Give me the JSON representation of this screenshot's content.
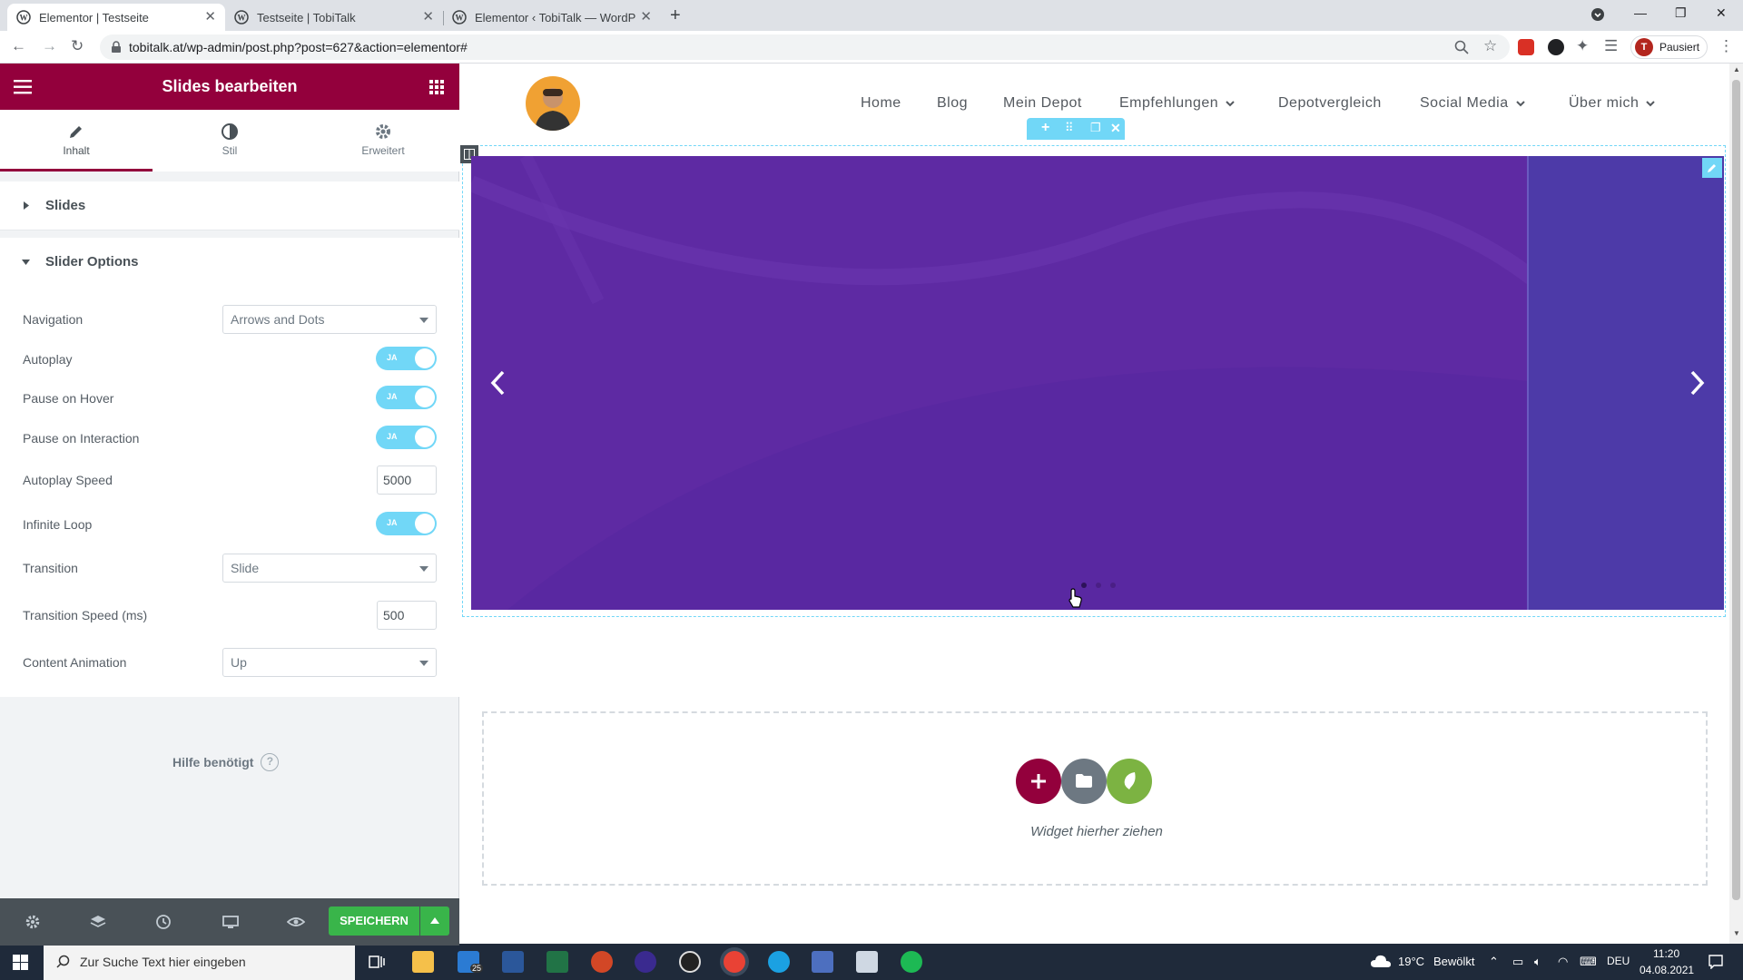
{
  "browser": {
    "tabs": [
      {
        "title": "Elementor | Testseite",
        "active": true
      },
      {
        "title": "Testseite | TobiTalk",
        "active": false
      },
      {
        "title": "Elementor ‹ TobiTalk — WordPress",
        "active": false
      }
    ],
    "url": "tobitalk.at/wp-admin/post.php?post=627&action=elementor#",
    "profile_initial": "T",
    "profile_status": "Pausiert"
  },
  "panel": {
    "title": "Slides bearbeiten",
    "tabs": [
      {
        "label": "Inhalt",
        "icon": "pencil-icon"
      },
      {
        "label": "Stil",
        "icon": "contrast-icon"
      },
      {
        "label": "Erweitert",
        "icon": "gear-icon"
      }
    ],
    "sections": {
      "slides": "Slides",
      "slider_options": "Slider Options"
    },
    "options": {
      "navigation": {
        "label": "Navigation",
        "value": "Arrows and Dots"
      },
      "autoplay": {
        "label": "Autoplay",
        "value": "JA"
      },
      "pause_hover": {
        "label": "Pause on Hover",
        "value": "JA"
      },
      "pause_interaction": {
        "label": "Pause on Interaction",
        "value": "JA"
      },
      "autoplay_speed": {
        "label": "Autoplay Speed",
        "value": "5000"
      },
      "infinite_loop": {
        "label": "Infinite Loop",
        "value": "JA"
      },
      "transition": {
        "label": "Transition",
        "value": "Slide"
      },
      "transition_speed": {
        "label": "Transition Speed (ms)",
        "value": "500"
      },
      "content_animation": {
        "label": "Content Animation",
        "value": "Up"
      }
    },
    "help": "Hilfe benötigt",
    "help_icon": "?",
    "save_label": "SPEICHERN"
  },
  "site": {
    "nav": [
      {
        "label": "Home",
        "dropdown": false
      },
      {
        "label": "Blog",
        "dropdown": false
      },
      {
        "label": "Mein Depot",
        "dropdown": false
      },
      {
        "label": "Empfehlungen",
        "dropdown": true
      },
      {
        "label": "Depotvergleich",
        "dropdown": false
      },
      {
        "label": "Social Media",
        "dropdown": true
      },
      {
        "label": "Über mich",
        "dropdown": true
      }
    ],
    "slide_color": "#5e2aa3",
    "dropzone_text": "Widget hierher ziehen"
  },
  "taskbar": {
    "search_placeholder": "Zur Suche Text hier eingeben",
    "weather_temp": "19°C",
    "weather_text": "Bewölkt",
    "lang": "DEU",
    "time": "11:20",
    "date": "04.08.2021",
    "mail_badge": "25"
  },
  "colors": {
    "brand": "#93003c",
    "toggle": "#71d7f7",
    "save": "#39b54a"
  }
}
